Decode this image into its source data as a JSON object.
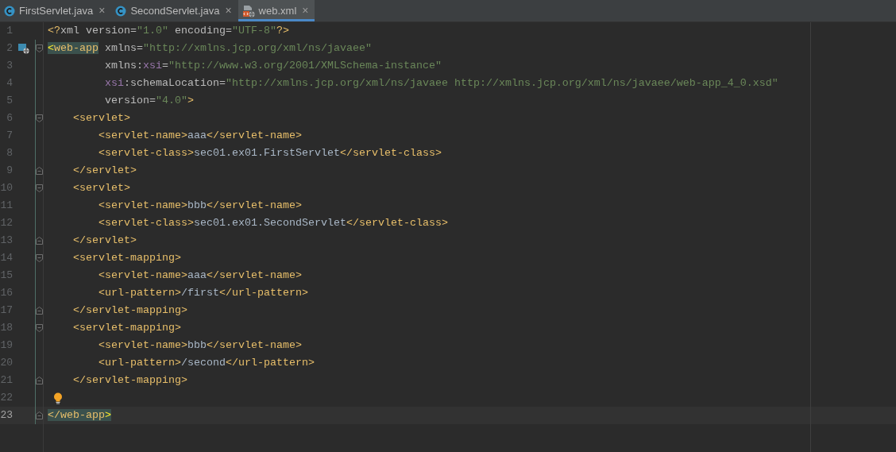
{
  "tabs": [
    {
      "label": "FirstServlet.java",
      "kind": "java",
      "selected": false,
      "close": "×"
    },
    {
      "label": "SecondServlet.java",
      "kind": "java",
      "selected": false,
      "close": "×"
    },
    {
      "label": "web.xml",
      "kind": "xml",
      "selected": true,
      "close": "×"
    }
  ],
  "editor": {
    "lines": [
      {
        "number": "1",
        "tokens": [
          {
            "kind": "tag",
            "s": "<?"
          },
          {
            "kind": "attr",
            "s": "xml version"
          },
          {
            "kind": "attr",
            "s": "="
          },
          {
            "kind": "value",
            "s": "\"1.0\""
          },
          {
            "kind": "attr",
            "s": " encoding"
          },
          {
            "kind": "attr",
            "s": "="
          },
          {
            "kind": "value",
            "s": "\"UTF-8\""
          },
          {
            "kind": "tag",
            "s": "?>"
          }
        ]
      },
      {
        "number": "2",
        "gutter_icon": true,
        "fold_start": true,
        "tokens": [
          {
            "kind": "bracket",
            "s": "<",
            "matched": true
          },
          {
            "kind": "tag",
            "s": "web-app",
            "matched": true
          },
          {
            "kind": "attr",
            "s": " xmlns="
          },
          {
            "kind": "value",
            "s": "\"http://xmlns.jcp.org/xml/ns/javaee\""
          }
        ]
      },
      {
        "number": "3",
        "tokens": [
          {
            "kind": "attr",
            "s": "         xmlns:"
          },
          {
            "kind": "ns",
            "s": "xsi"
          },
          {
            "kind": "attr",
            "s": "="
          },
          {
            "kind": "value",
            "s": "\"http://www.w3.org/2001/XMLSchema-instance\""
          }
        ]
      },
      {
        "number": "4",
        "tokens": [
          {
            "kind": "ns",
            "s": "         xsi"
          },
          {
            "kind": "attr",
            "s": ":schemaLocation="
          },
          {
            "kind": "value",
            "s": "\"http://xmlns.jcp.org/xml/ns/javaee http://xmlns.jcp.org/xml/ns/javaee/web-app_4_0.xsd\""
          }
        ]
      },
      {
        "number": "5",
        "tokens": [
          {
            "kind": "attr",
            "s": "         version="
          },
          {
            "kind": "value",
            "s": "\"4.0\""
          },
          {
            "kind": "tag",
            "s": ">"
          }
        ]
      },
      {
        "number": "6",
        "fold_start": true,
        "tokens": [
          {
            "kind": "tag",
            "s": "    <servlet>"
          }
        ]
      },
      {
        "number": "7",
        "tokens": [
          {
            "kind": "tag",
            "s": "        <servlet-name>"
          },
          {
            "kind": "text",
            "s": "aaa"
          },
          {
            "kind": "tag",
            "s": "</servlet-name>"
          }
        ]
      },
      {
        "number": "8",
        "tokens": [
          {
            "kind": "tag",
            "s": "        <servlet-class>"
          },
          {
            "kind": "text",
            "s": "sec01.ex01.FirstServlet"
          },
          {
            "kind": "tag",
            "s": "</servlet-class>"
          }
        ]
      },
      {
        "number": "9",
        "fold_end": true,
        "tokens": [
          {
            "kind": "tag",
            "s": "    </servlet>"
          }
        ]
      },
      {
        "number": "10",
        "fold_start": true,
        "tokens": [
          {
            "kind": "tag",
            "s": "    <servlet>"
          }
        ]
      },
      {
        "number": "11",
        "tokens": [
          {
            "kind": "tag",
            "s": "        <servlet-name>"
          },
          {
            "kind": "text",
            "s": "bbb"
          },
          {
            "kind": "tag",
            "s": "</servlet-name>"
          }
        ]
      },
      {
        "number": "12",
        "tokens": [
          {
            "kind": "tag",
            "s": "        <servlet-class>"
          },
          {
            "kind": "text",
            "s": "sec01.ex01.SecondServlet"
          },
          {
            "kind": "tag",
            "s": "</servlet-class>"
          }
        ]
      },
      {
        "number": "13",
        "fold_end": true,
        "tokens": [
          {
            "kind": "tag",
            "s": "    </servlet>"
          }
        ]
      },
      {
        "number": "14",
        "fold_start": true,
        "tokens": [
          {
            "kind": "tag",
            "s": "    <servlet-mapping>"
          }
        ]
      },
      {
        "number": "15",
        "tokens": [
          {
            "kind": "tag",
            "s": "        <servlet-name>"
          },
          {
            "kind": "text",
            "s": "aaa"
          },
          {
            "kind": "tag",
            "s": "</servlet-name>"
          }
        ]
      },
      {
        "number": "16",
        "tokens": [
          {
            "kind": "tag",
            "s": "        <url-pattern>"
          },
          {
            "kind": "text",
            "s": "/first"
          },
          {
            "kind": "tag",
            "s": "</url-pattern>"
          }
        ]
      },
      {
        "number": "17",
        "fold_end": true,
        "tokens": [
          {
            "kind": "tag",
            "s": "    </servlet-mapping>"
          }
        ]
      },
      {
        "number": "18",
        "fold_start": true,
        "tokens": [
          {
            "kind": "tag",
            "s": "    <servlet-mapping>"
          }
        ]
      },
      {
        "number": "19",
        "tokens": [
          {
            "kind": "tag",
            "s": "        <servlet-name>"
          },
          {
            "kind": "text",
            "s": "bbb"
          },
          {
            "kind": "tag",
            "s": "</servlet-name>"
          }
        ]
      },
      {
        "number": "20",
        "tokens": [
          {
            "kind": "tag",
            "s": "        <url-pattern>"
          },
          {
            "kind": "text",
            "s": "/second"
          },
          {
            "kind": "tag",
            "s": "</url-pattern>"
          }
        ]
      },
      {
        "number": "21",
        "fold_end": true,
        "tokens": [
          {
            "kind": "tag",
            "s": "    </servlet-mapping>"
          }
        ]
      },
      {
        "number": "22",
        "bulb": true
      },
      {
        "number": "23",
        "current": true,
        "fold_end": true,
        "tokens": [
          {
            "kind": "tag",
            "s": "</web-app",
            "matched": true
          },
          {
            "kind": "bracket",
            "s": ">",
            "matched": true
          }
        ]
      }
    ]
  }
}
